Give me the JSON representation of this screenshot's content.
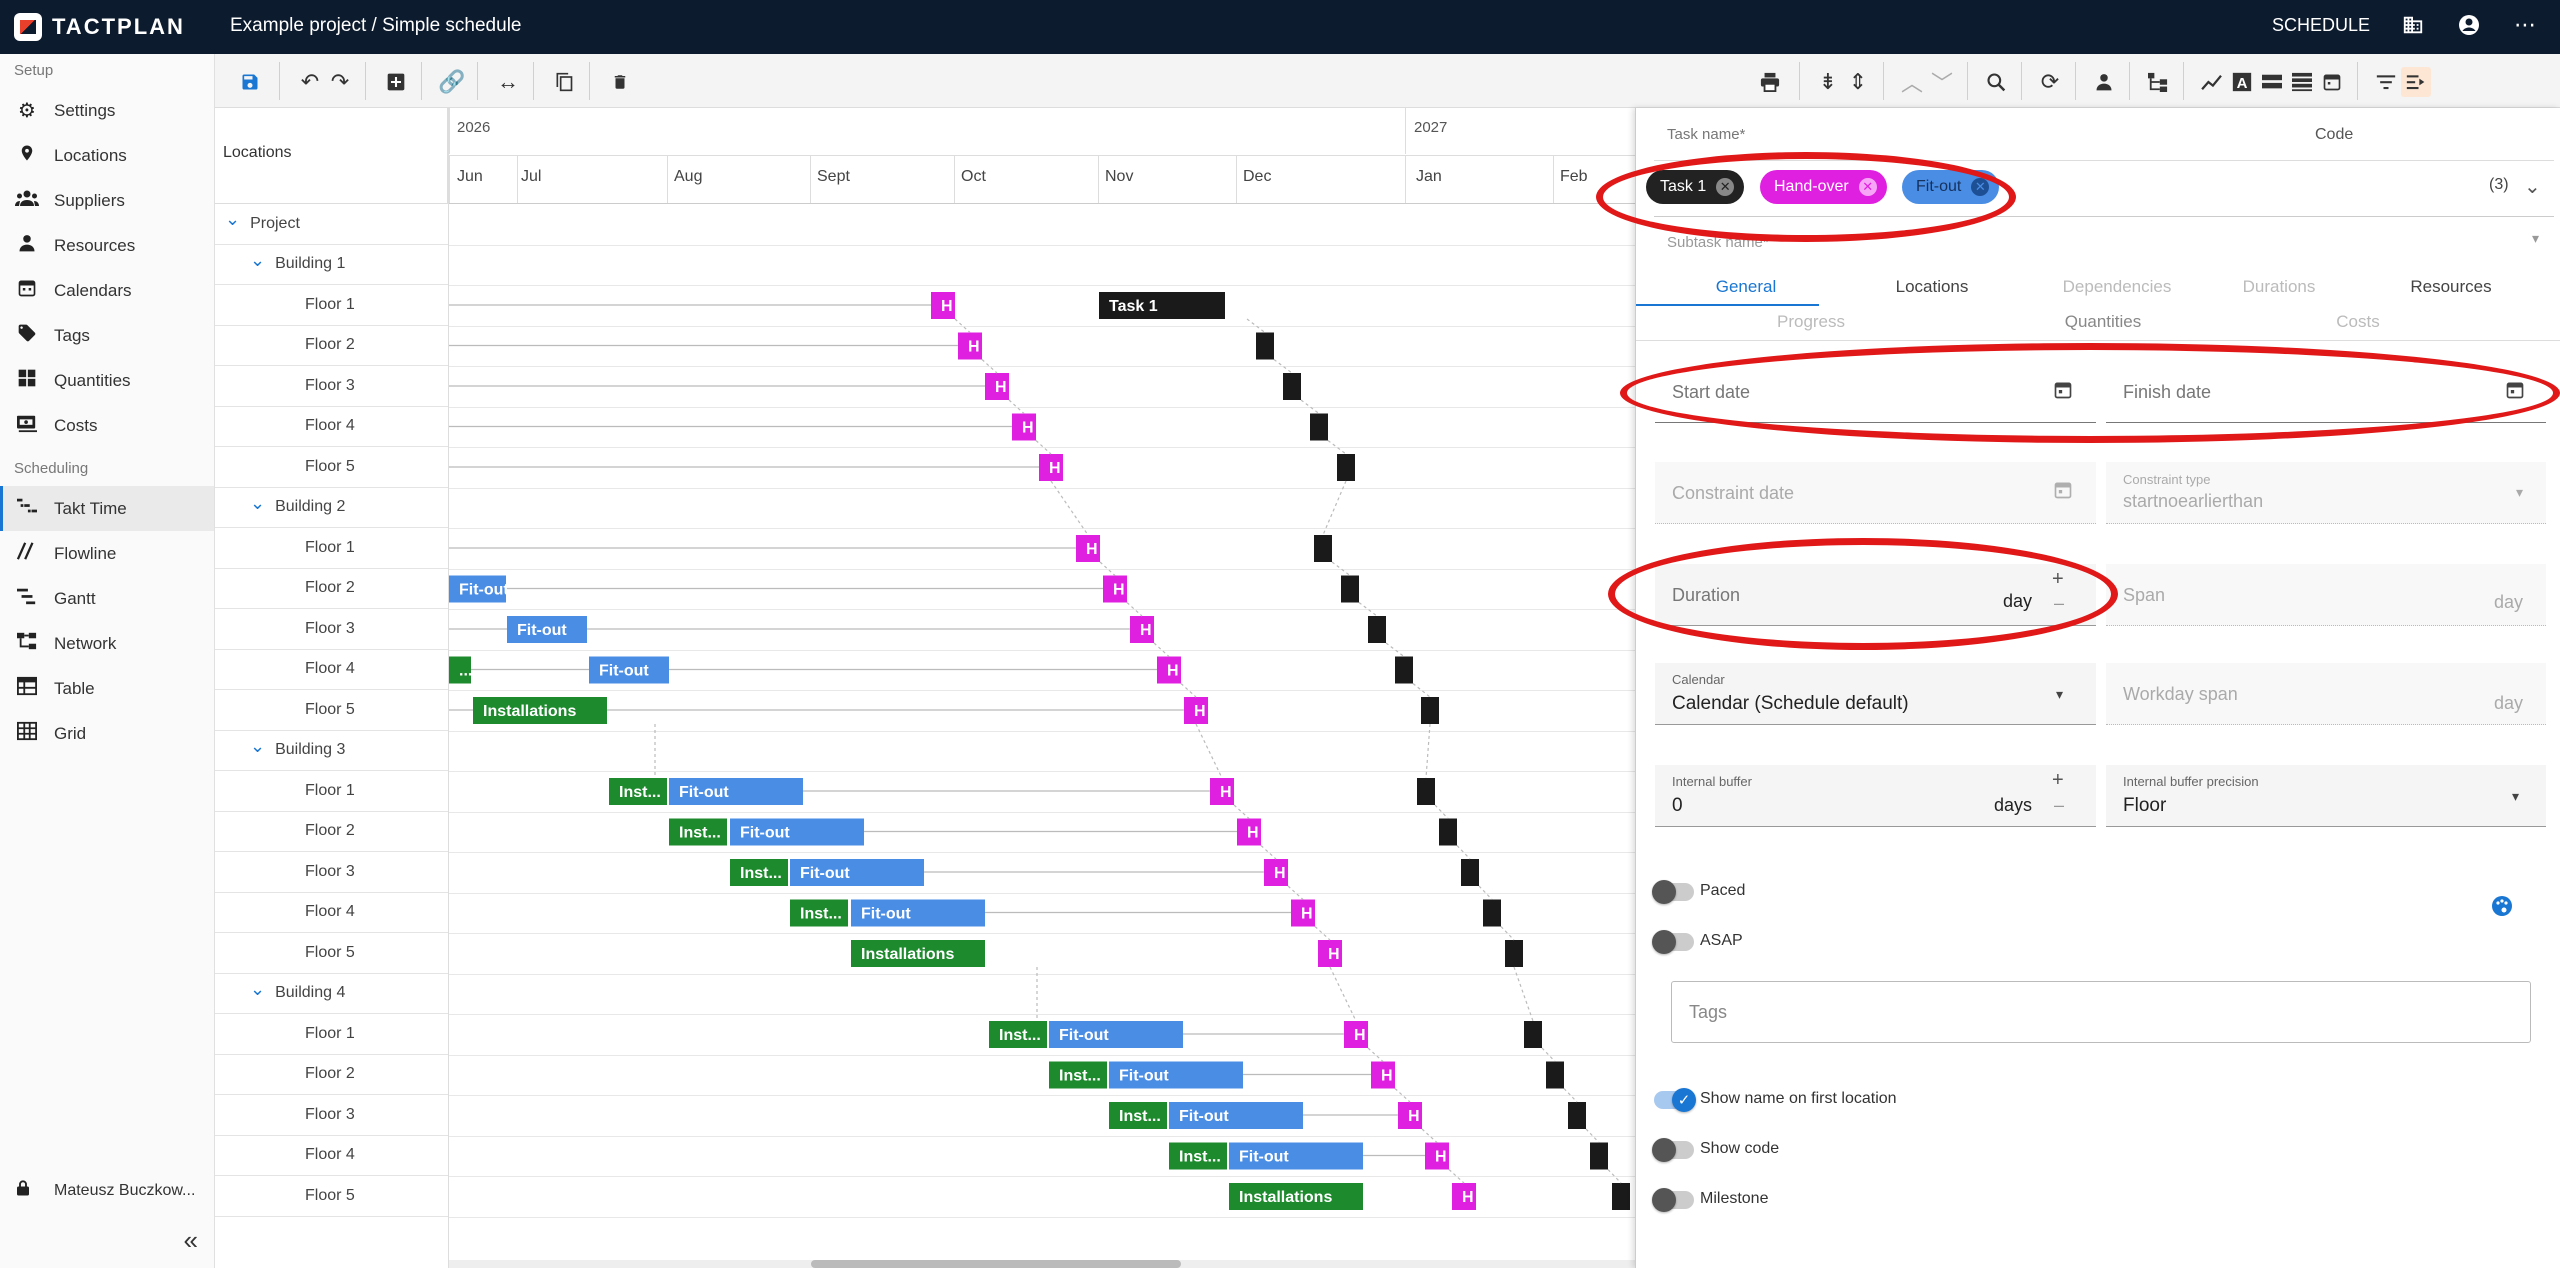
{
  "topbar": {
    "logo_text": "TACTPLAN",
    "title": "Example project / Simple schedule",
    "schedule_label": "SCHEDULE",
    "icons": [
      "building-icon",
      "account-icon",
      "more-icon"
    ]
  },
  "sidebar": {
    "setup_label": "Setup",
    "setup_items": [
      {
        "label": "Settings",
        "icon": "settings-icon"
      },
      {
        "label": "Locations",
        "icon": "location-pin-icon"
      },
      {
        "label": "Suppliers",
        "icon": "suppliers-icon"
      },
      {
        "label": "Resources",
        "icon": "person-icon"
      },
      {
        "label": "Calendars",
        "icon": "calendar-icon"
      },
      {
        "label": "Tags",
        "icon": "tag-icon"
      },
      {
        "label": "Quantities",
        "icon": "quantities-icon"
      },
      {
        "label": "Costs",
        "icon": "costs-icon"
      }
    ],
    "scheduling_label": "Scheduling",
    "scheduling_items": [
      {
        "label": "Takt Time",
        "icon": "takt-icon",
        "active": true
      },
      {
        "label": "Flowline",
        "icon": "flowline-icon"
      },
      {
        "label": "Gantt",
        "icon": "gantt-icon"
      },
      {
        "label": "Network",
        "icon": "network-icon"
      },
      {
        "label": "Table",
        "icon": "table-icon"
      },
      {
        "label": "Grid",
        "icon": "grid-icon"
      }
    ],
    "user_name": "Mateusz Buczkow..."
  },
  "gantt": {
    "locations_header": "Locations",
    "years": [
      {
        "label": "2026"
      },
      {
        "label": "2027"
      }
    ],
    "months": [
      "Jun",
      "Jul",
      "Aug",
      "Sept",
      "Oct",
      "Nov",
      "Dec",
      "Jan",
      "Feb"
    ],
    "locations": [
      {
        "label": "Project",
        "level": 0,
        "expanded": true
      },
      {
        "label": "Building 1",
        "level": 1,
        "expanded": true
      },
      {
        "label": "Floor 1",
        "level": 2
      },
      {
        "label": "Floor 2",
        "level": 2
      },
      {
        "label": "Floor 3",
        "level": 2
      },
      {
        "label": "Floor 4",
        "level": 2
      },
      {
        "label": "Floor 5",
        "level": 2
      },
      {
        "label": "Building 2",
        "level": 1,
        "expanded": true
      },
      {
        "label": "Floor 1",
        "level": 2
      },
      {
        "label": "Floor 2",
        "level": 2
      },
      {
        "label": "Floor 3",
        "level": 2
      },
      {
        "label": "Floor 4",
        "level": 2
      },
      {
        "label": "Floor 5",
        "level": 2
      },
      {
        "label": "Building 3",
        "level": 1,
        "expanded": true
      },
      {
        "label": "Floor 1",
        "level": 2
      },
      {
        "label": "Floor 2",
        "level": 2
      },
      {
        "label": "Floor 3",
        "level": 2
      },
      {
        "label": "Floor 4",
        "level": 2
      },
      {
        "label": "Floor 5",
        "level": 2
      },
      {
        "label": "Building 4",
        "level": 1,
        "expanded": true
      },
      {
        "label": "Floor 1",
        "level": 2
      },
      {
        "label": "Floor 2",
        "level": 2
      },
      {
        "label": "Floor 3",
        "level": 2
      },
      {
        "label": "Floor 4",
        "level": 2
      },
      {
        "label": "Floor 5",
        "level": 2
      }
    ],
    "colors": {
      "fitout": "#4a8de4",
      "install": "#1e8a2e",
      "handover": "#e020e0",
      "task1": "#1a1a1a"
    },
    "bar_labels": {
      "fitout": "Fit-out",
      "install_short": "Inst...",
      "install_full": "Installations",
      "task1": "Task 1",
      "install_tiny": "...",
      "handover": "H"
    }
  },
  "panel": {
    "task_name_label": "Task name*",
    "code_label": "Code",
    "chips": [
      {
        "label": "Task 1",
        "bg": "#222222",
        "fg": "#ffffff"
      },
      {
        "label": "Hand-over",
        "bg": "#e020e0",
        "fg": "#ffffff"
      },
      {
        "label": "Fit-out",
        "bg": "#4a8de4",
        "fg": "#ffffff"
      }
    ],
    "chip_count": "(3)",
    "subtask_label": "Subtask name*",
    "tabs_row1": [
      "General",
      "Locations",
      "Dependencies",
      "Durations",
      "Resources"
    ],
    "tabs_row2": [
      "Progress",
      "Quantities",
      "Costs"
    ],
    "start_date_label": "Start date",
    "finish_date_label": "Finish date",
    "constraint_date_label": "Constraint date",
    "constraint_type_label": "Constraint type",
    "constraint_type_value": "startnoearlierthan",
    "duration_label": "Duration",
    "duration_unit": "day",
    "span_label": "Span",
    "span_unit": "day",
    "calendar_label": "Calendar",
    "calendar_value": "Calendar (Schedule default)",
    "workday_span_label": "Workday span",
    "workday_span_unit": "day",
    "internal_buffer_label": "Internal buffer",
    "internal_buffer_value": "0",
    "internal_buffer_unit": "days",
    "buffer_precision_label": "Internal buffer precision",
    "buffer_precision_value": "Floor",
    "paced_label": "Paced",
    "asap_label": "ASAP",
    "tags_placeholder": "Tags",
    "show_name_label": "Show name on first location",
    "show_code_label": "Show code",
    "milestone_label": "Milestone"
  }
}
